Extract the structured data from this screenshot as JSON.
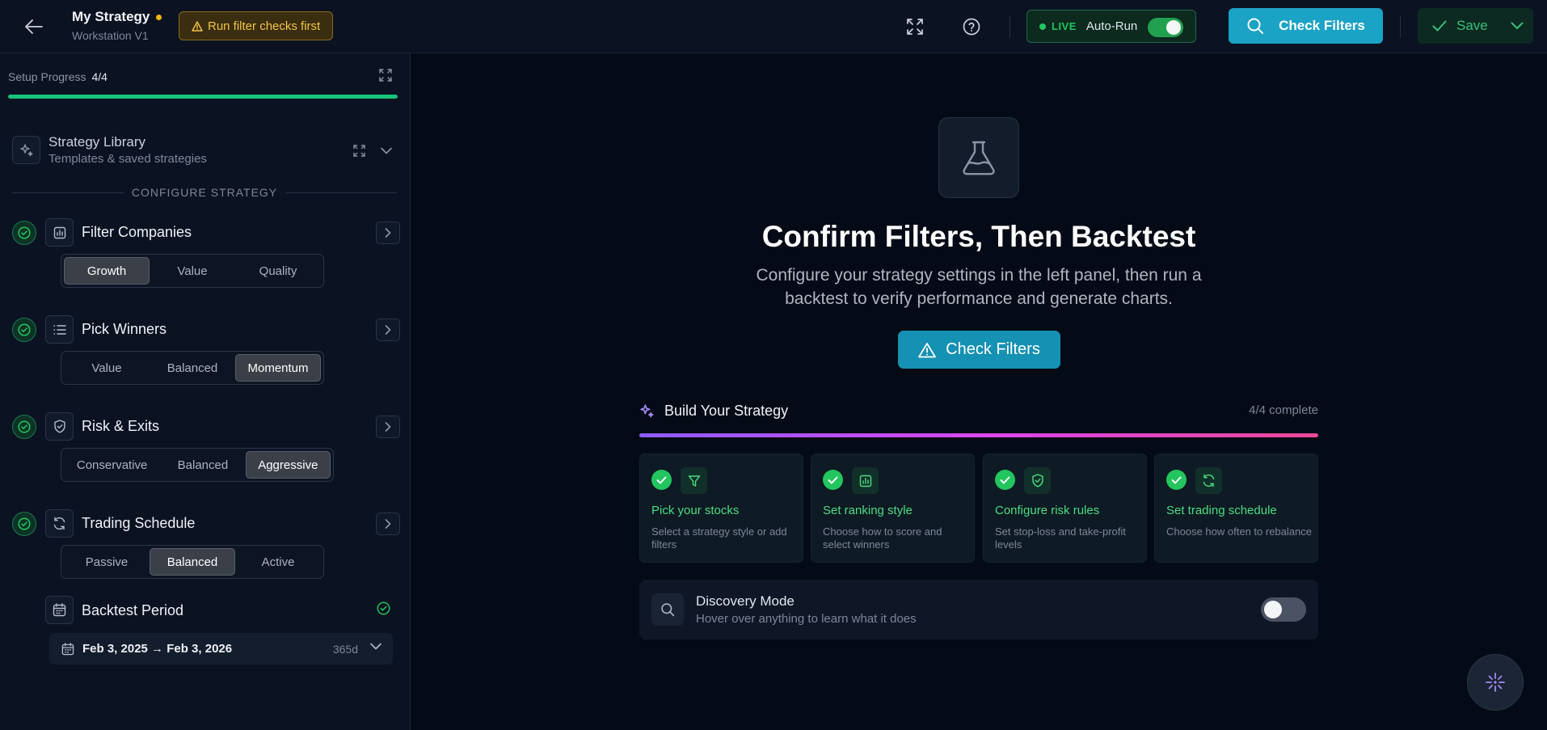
{
  "header": {
    "title": "My Strategy",
    "subtitle": "Workstation V1",
    "warning": "Run filter checks first",
    "live_label": "LIVE",
    "autorun_label": "Auto-Run",
    "autorun_enabled": true,
    "check_filters_label": "Check Filters",
    "save_label": "Save"
  },
  "sidebar": {
    "progress_label": "Setup Progress",
    "progress_value": "4/4",
    "progress_fraction": 1.0,
    "library": {
      "title": "Strategy Library",
      "subtitle": "Templates & saved strategies"
    },
    "section_label": "CONFIGURE STRATEGY",
    "steps": [
      {
        "title": "Filter Companies",
        "icon": "chart-bars-icon",
        "options": [
          "Growth",
          "Value",
          "Quality"
        ],
        "selected": "Growth"
      },
      {
        "title": "Pick Winners",
        "icon": "list-icon",
        "options": [
          "Value",
          "Balanced",
          "Momentum"
        ],
        "selected": "Momentum"
      },
      {
        "title": "Risk & Exits",
        "icon": "shield-icon",
        "options": [
          "Conservative",
          "Balanced",
          "Aggressive"
        ],
        "selected": "Aggressive"
      },
      {
        "title": "Trading Schedule",
        "icon": "refresh-icon",
        "options": [
          "Passive",
          "Balanced",
          "Active"
        ],
        "selected": "Balanced"
      }
    ],
    "backtest": {
      "title": "Backtest Period",
      "range": "Feb 3, 2025 → Feb 3, 2026",
      "days": "365d"
    }
  },
  "main": {
    "heading": "Confirm Filters, Then Backtest",
    "description": "Configure your strategy settings in the left panel, then run a backtest to verify performance and generate charts.",
    "check_filters_label": "Check Filters",
    "build": {
      "title": "Build Your Strategy",
      "count": "4/4 complete",
      "progress_fraction": 1.0,
      "cards": [
        {
          "title": "Pick your stocks",
          "desc": "Select a strategy style or add filters",
          "icon": "filter-icon"
        },
        {
          "title": "Set ranking style",
          "desc": "Choose how to score and select winners",
          "icon": "chart-bars-icon"
        },
        {
          "title": "Configure risk rules",
          "desc": "Set stop-loss and take-profit levels",
          "icon": "shield-icon"
        },
        {
          "title": "Set trading schedule",
          "desc": "Choose how often to rebalance",
          "icon": "refresh-icon"
        }
      ]
    },
    "discovery": {
      "title": "Discovery Mode",
      "subtitle": "Hover over anything to learn what it does",
      "enabled": false
    }
  },
  "colors": {
    "accent": "#1ba3c6",
    "success": "#22c55e",
    "warning": "#f5c445",
    "background": "#050b16",
    "panel": "#0b1322"
  }
}
